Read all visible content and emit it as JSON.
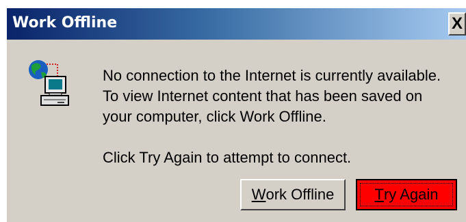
{
  "window": {
    "title": "Work Offline",
    "close_label": "X"
  },
  "message": {
    "line1": "No connection to the Internet is currently available.",
    "line2": "To view Internet content that has been saved on",
    "line3": "your computer, click Work Offline.",
    "line4": "Click Try Again to attempt to connect."
  },
  "buttons": {
    "work_offline": {
      "mnemonic": "W",
      "rest": "ork Offline"
    },
    "try_again": {
      "mnemonic": "T",
      "rest": "ry Again"
    }
  },
  "icon": "offline-computer-icon",
  "colors": {
    "titlebar_start": "#0a246a",
    "titlebar_end": "#a6caf0",
    "dialog_bg": "#d4d0c8",
    "default_button_bg": "#ff0000"
  }
}
